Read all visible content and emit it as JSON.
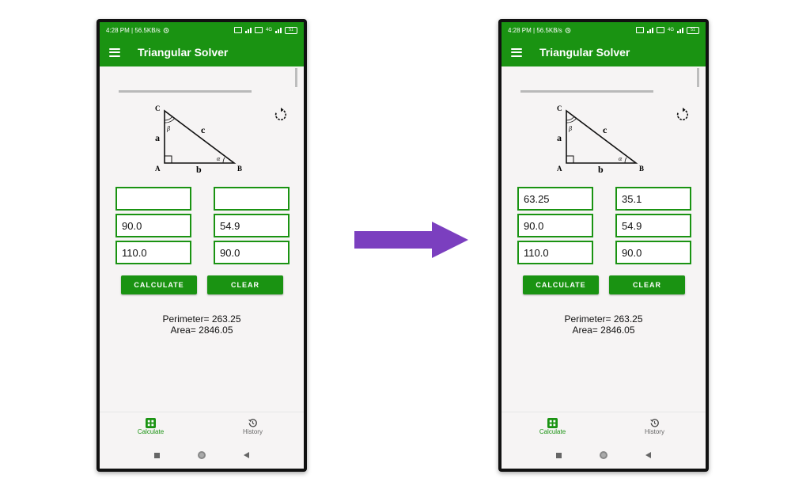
{
  "status": {
    "time_speed": "4:28 PM | 56.5KB/s",
    "network": "4G",
    "battery": "51"
  },
  "app": {
    "title": "Triangular Solver"
  },
  "diagram": {
    "vertices": [
      "C",
      "A",
      "B"
    ],
    "sides": [
      "a",
      "b",
      "c"
    ],
    "angles": [
      "β",
      "α"
    ]
  },
  "icons": {
    "menu": "hamburger-icon",
    "reset": "rotate-refresh-icon",
    "calculate": "grid-calculator-icon",
    "history": "history-clock-icon"
  },
  "buttons": {
    "calculate": "CALCULATE",
    "clear": "CLEAR"
  },
  "nav": {
    "calculate": "Calculate",
    "history": "History"
  },
  "colors": {
    "brand": "#1a9312",
    "arrow": "#7b3fbf"
  },
  "before": {
    "fields": {
      "r1c1": "",
      "r1c2": "",
      "r2c1": "90.0",
      "r2c2": "54.9",
      "r3c1": "110.0",
      "r3c2": "90.0"
    },
    "results": {
      "perimeter": "Perimeter= 263.25",
      "area": "Area= 2846.05"
    }
  },
  "after": {
    "fields": {
      "r1c1": "63.25",
      "r1c2": "35.1",
      "r2c1": "90.0",
      "r2c2": "54.9",
      "r3c1": "110.0",
      "r3c2": "90.0"
    },
    "results": {
      "perimeter": "Perimeter= 263.25",
      "area": "Area= 2846.05"
    }
  }
}
